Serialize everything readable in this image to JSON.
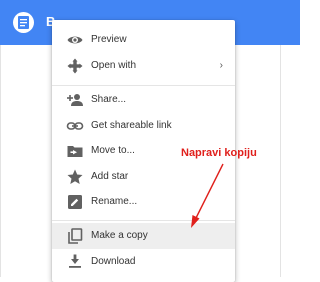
{
  "header": {
    "file_name": "B",
    "file_icon": "google-docs-icon",
    "accent_color": "#4285f4"
  },
  "menu": {
    "items": [
      {
        "label": "Preview",
        "icon": "eye-icon"
      },
      {
        "label": "Open with",
        "icon": "open-with-icon",
        "chevron": "›"
      },
      {
        "label": "Share...",
        "icon": "add-person-icon"
      },
      {
        "label": "Get shareable link",
        "icon": "link-icon"
      },
      {
        "label": "Move to...",
        "icon": "move-folder-icon"
      },
      {
        "label": "Add star",
        "icon": "star-icon"
      },
      {
        "label": "Rename...",
        "icon": "rename-icon"
      },
      {
        "label": "Make a copy",
        "icon": "copy-icon",
        "highlighted": true
      },
      {
        "label": "Download",
        "icon": "download-icon"
      }
    ]
  },
  "annotation": {
    "text": "Napravi kopiju",
    "color": "#e0201c"
  }
}
